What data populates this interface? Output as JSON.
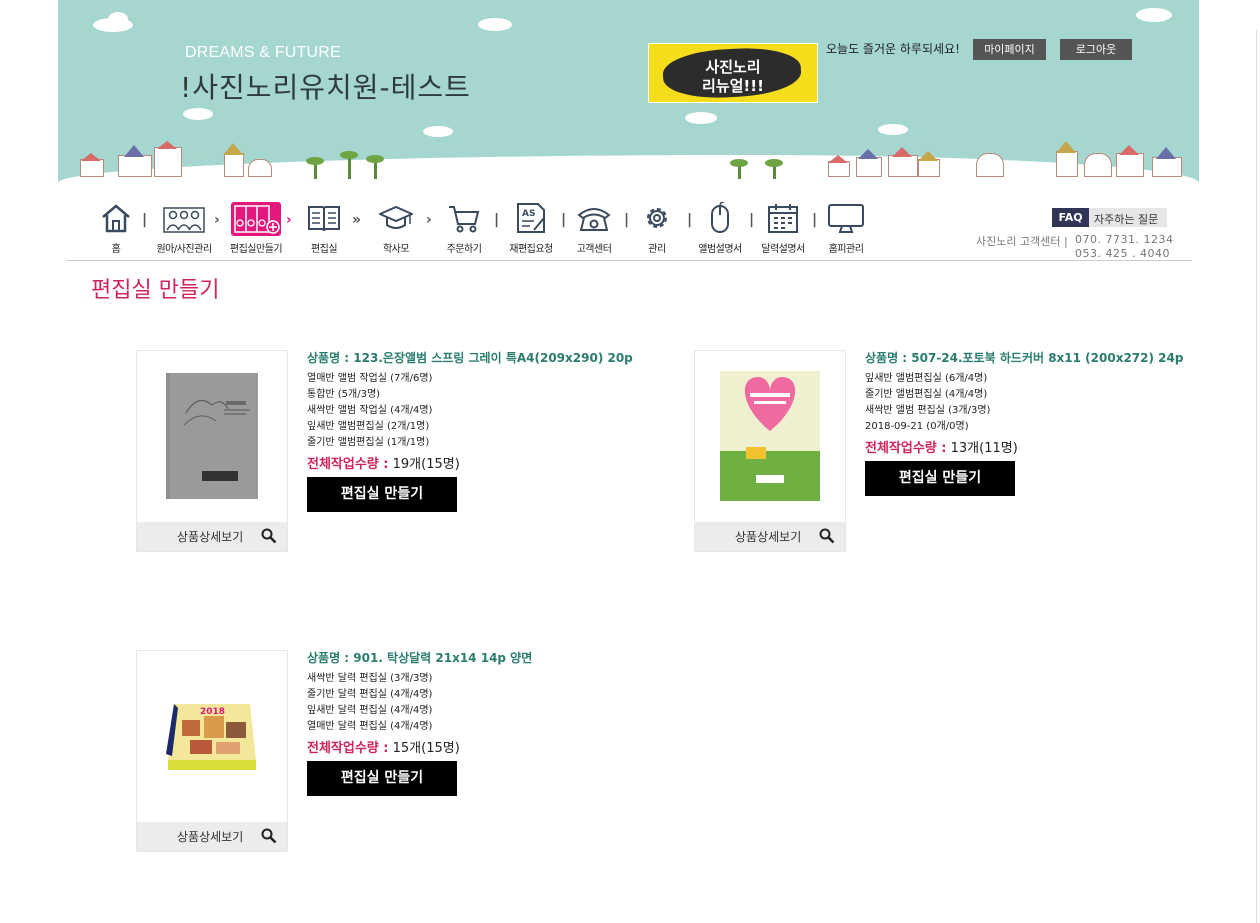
{
  "header": {
    "brand_sub": "DREAMS & FUTURE",
    "brand_title": "!사진노리유치원-테스트",
    "banner_line1": "사진노리",
    "banner_line2": "리뉴얼!!!",
    "greeting": "오늘도 즐거운 하루되세요!",
    "mypage_label": "마이페이지",
    "logout_label": "로그아웃",
    "bg_color": "#a5d7d0"
  },
  "nav": {
    "items": [
      {
        "label": "홈",
        "icon": "home-icon"
      },
      {
        "label": "원아/사진관리",
        "icon": "people-icon"
      },
      {
        "label": "편집실만들기",
        "icon": "album-plus-icon"
      },
      {
        "label": "편집실",
        "icon": "book-icon"
      },
      {
        "label": "학사모",
        "icon": "graduation-cap-icon"
      },
      {
        "label": "주문하기",
        "icon": "cart-icon"
      },
      {
        "label": "재편집요청",
        "icon": "as-edit-icon"
      },
      {
        "label": "고객센터",
        "icon": "phone-icon"
      },
      {
        "label": "관리",
        "icon": "gear-icon"
      },
      {
        "label": "앨범설명서",
        "icon": "mouse-icon"
      },
      {
        "label": "달력설명서",
        "icon": "calendar-icon"
      },
      {
        "label": "홈피관리",
        "icon": "monitor-icon"
      }
    ]
  },
  "support": {
    "faq_tag": "FAQ",
    "faq_text": "자주하는 질문",
    "center_label": "사진노리 고객센터 |",
    "phone1": "070. 7731. 1234",
    "phone2": "053. 425 . 4040"
  },
  "page": {
    "title": "편집실 만들기"
  },
  "products": [
    {
      "name": "상품명 : 123.은장앨범 스프링 그레이 특A4(209x290) 20p",
      "classes": [
        "열매반 앨범 작업실 (7개/6명)",
        "통합반 (5개/3명)",
        "새싹반 앨범 작업실 (4개/4명)",
        "잎새반 앨범편집실 (2개/1명)",
        "줄기반 앨범편집실 (1개/1명)"
      ],
      "total_label": "전체작업수량 :",
      "total_value": "19개(15명)",
      "make_label": "편집실 만들기",
      "detail_label": "상품상세보기"
    },
    {
      "name": "상품명 : 507-24.포토북 하드커버 8x11 (200x272) 24p",
      "classes": [
        "잎새반 앨범편집실 (6개/4명)",
        "줄기반 앨범편집실 (4개/4명)",
        "새싹반 앨범 편집실 (3개/3명)",
        "2018-09-21 (0개/0명)"
      ],
      "total_label": "전체작업수량 :",
      "total_value": "13개(11명)",
      "make_label": "편집실 만들기",
      "detail_label": "상품상세보기"
    },
    {
      "name": "상품명 : 901. 탁상달력 21x14 14p 양면",
      "classes": [
        "새싹반 달력 편집실 (3개/3명)",
        "줄기반 달력 편집실 (4개/4명)",
        "잎새반 달력 편집실 (4개/4명)",
        "열매반 달력 편집실 (4개/4명)"
      ],
      "total_label": "전체작업수량 :",
      "total_value": "15개(15명)",
      "make_label": "편집실 만들기",
      "detail_label": "상품상세보기",
      "thumb_year": "2018"
    }
  ]
}
